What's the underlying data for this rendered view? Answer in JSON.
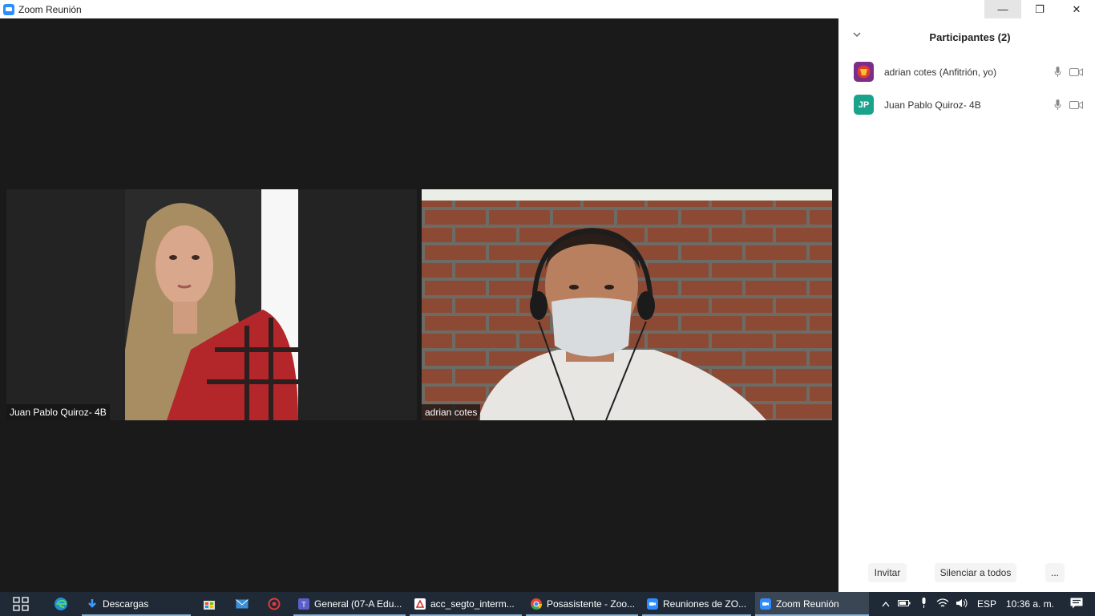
{
  "window": {
    "title": "Zoom Reunión",
    "minimize_glyph": "—",
    "restore_glyph": "❐",
    "close_glyph": "✕"
  },
  "videos": [
    {
      "name": "Juan Pablo Quiroz- 4B"
    },
    {
      "name": "adrian cotes"
    }
  ],
  "panel": {
    "title": "Participantes (2)",
    "participants": [
      {
        "name": "adrian cotes (Anfitrión, yo)",
        "avatar": "avatar-image"
      },
      {
        "name": "Juan Pablo Quiroz- 4B",
        "avatar": "JP"
      }
    ],
    "footer": {
      "invite": "Invitar",
      "mute_all": "Silenciar a todos",
      "more": "..."
    }
  },
  "taskbar": {
    "apps": [
      {
        "label": "Descargas",
        "icon": "download-icon"
      },
      {
        "label": "General (07-A Edu...",
        "icon": "teams-icon"
      },
      {
        "label": "acc_segto_interm...",
        "icon": "pdf-icon"
      },
      {
        "label": "Posasistente - Zoo...",
        "icon": "chrome-icon"
      },
      {
        "label": "Reuniones de ZO...",
        "icon": "zoom-icon"
      },
      {
        "label": "Zoom Reunión",
        "icon": "zoom-icon"
      }
    ],
    "tray": {
      "language": "ESP",
      "time": "10:36 a. m."
    }
  },
  "colors": {
    "zoom_blue": "#2d8cff",
    "taskbar": "#1f2a36",
    "jp_avatar": "#1aa38c"
  }
}
